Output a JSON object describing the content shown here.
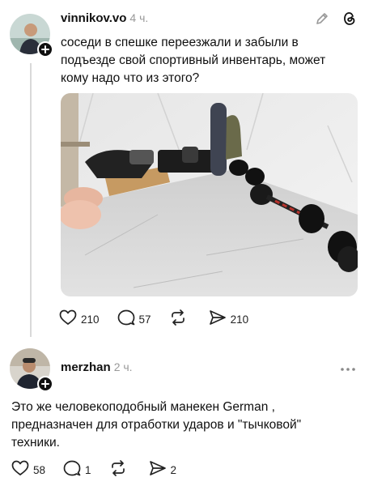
{
  "post": {
    "username": "vinnikov.vo",
    "time": "4 ч.",
    "text": "соседи в спешке переезжали и забыли в подъезде свой спортивный инвентарь, может кому надо что из этого?",
    "image_alt_icon": "photo-dumbbells-mannequin",
    "actions": {
      "likes": "210",
      "replies": "57",
      "reposts": "",
      "shares": "210"
    }
  },
  "reply": {
    "username": "merzhan",
    "time": "2 ч.",
    "text": "Это же человекоподобный манекен German , предназначен для отработки ударов и \"тычковой\" техники.",
    "actions": {
      "likes": "58",
      "replies": "1",
      "reposts": "",
      "shares": "2"
    }
  },
  "icons": {
    "edit": "pencil-icon",
    "threads": "threads-logo-icon",
    "more": "more-icon",
    "like": "heart-icon",
    "reply": "comment-icon",
    "repost": "repost-icon",
    "share": "send-icon"
  }
}
